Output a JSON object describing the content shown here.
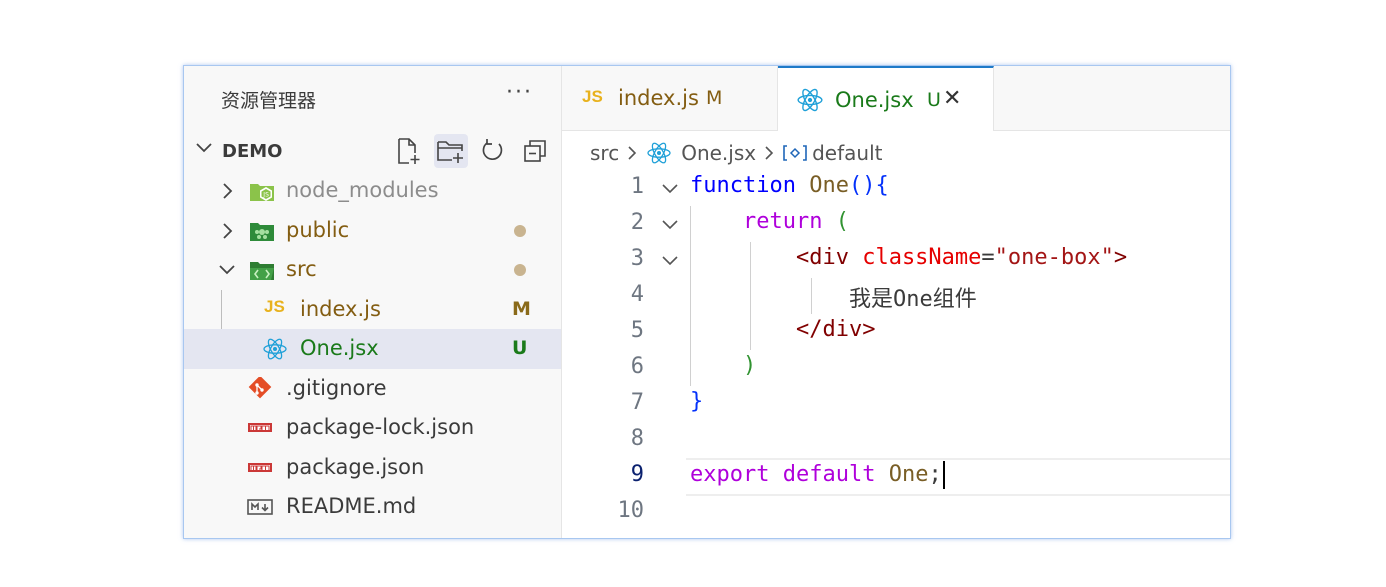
{
  "sidebar": {
    "title": "资源管理器",
    "more_label": "···",
    "project": "DEMO",
    "actions": [
      {
        "name": "new-file-icon"
      },
      {
        "name": "new-folder-icon"
      },
      {
        "name": "refresh-icon"
      },
      {
        "name": "collapse-all-icon"
      }
    ],
    "items": [
      {
        "label": "node_modules",
        "icon": "node-folder-icon",
        "color": "#8c8c8c",
        "badge": ""
      },
      {
        "label": "public",
        "icon": "public-folder-icon",
        "color": "#835d12",
        "badge": "dot"
      },
      {
        "label": "src",
        "icon": "src-folder-icon",
        "color": "#835d12",
        "badge": "dot"
      },
      {
        "label": "index.js",
        "icon": "js-icon",
        "color": "#835d12",
        "badge": "M"
      },
      {
        "label": "One.jsx",
        "icon": "react-icon",
        "color": "#1a7a1a",
        "badge": "U"
      },
      {
        "label": ".gitignore",
        "icon": "git-icon",
        "color": "#3b3b3b",
        "badge": ""
      },
      {
        "label": "package-lock.json",
        "icon": "npm-icon",
        "color": "#3b3b3b",
        "badge": ""
      },
      {
        "label": "package.json",
        "icon": "npm-icon",
        "color": "#3b3b3b",
        "badge": ""
      },
      {
        "label": "README.md",
        "icon": "markdown-icon",
        "color": "#3b3b3b",
        "badge": ""
      }
    ]
  },
  "tabs": [
    {
      "label": "index.js",
      "badge": "M",
      "icon_text": "JS"
    },
    {
      "label": "One.jsx",
      "badge": "U",
      "close": "✕"
    }
  ],
  "breadcrumb": {
    "a": "src",
    "b": "One.jsx",
    "c": "default"
  },
  "code": {
    "line_numbers": [
      "1",
      "2",
      "3",
      "4",
      "5",
      "6",
      "7",
      "8",
      "9",
      "10"
    ],
    "l1": {
      "k": "function",
      "f": "One",
      "p": "(){"
    },
    "l2": {
      "k": "return",
      "p": "("
    },
    "l3": {
      "t1": "<div",
      "a": "className",
      "eq": "=",
      "s": "\"one-box\"",
      "t2": ">"
    },
    "l4": {
      "text": "我是One组件"
    },
    "l5": {
      "t": "</div>"
    },
    "l6": {
      "p": ")"
    },
    "l7": {
      "p": "}"
    },
    "l9": {
      "k1": "export",
      "k2": "default",
      "f": "One",
      "semi": ";"
    }
  }
}
